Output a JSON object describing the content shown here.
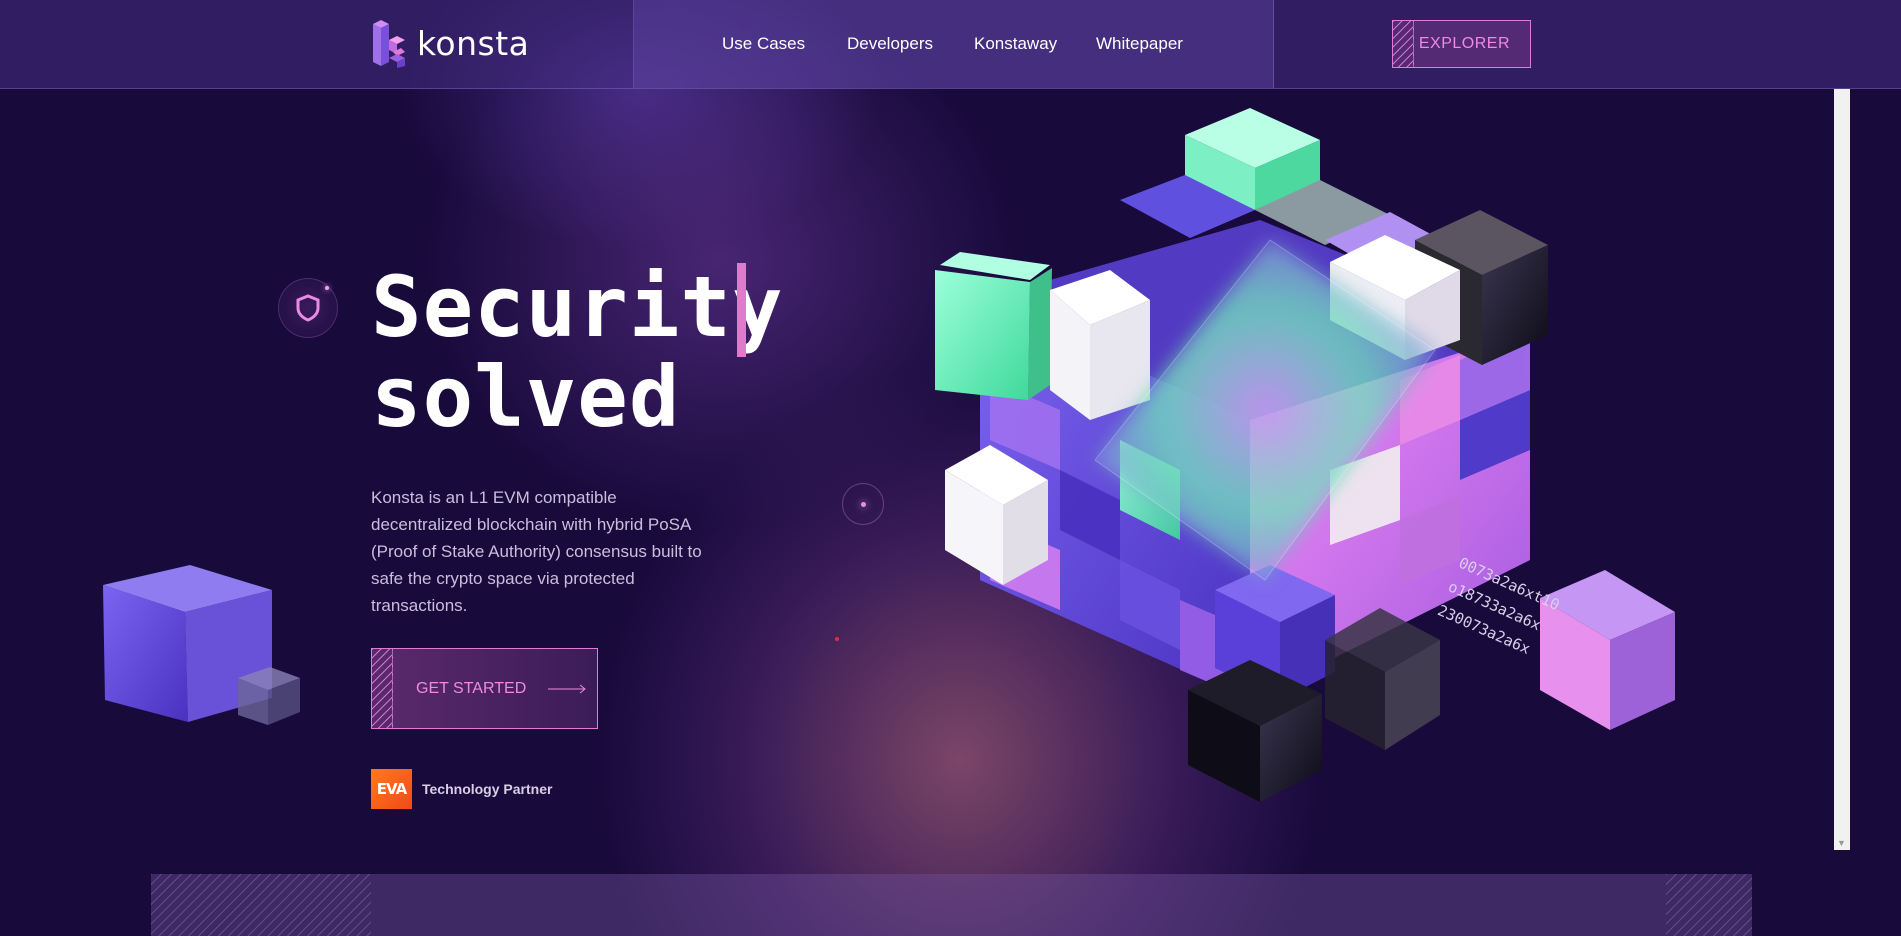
{
  "header": {
    "logo_text": "konsta",
    "nav": [
      "Use Cases",
      "Developers",
      "Konstaway",
      "Whitepaper"
    ],
    "explorer_label": "EXPLORER"
  },
  "hero": {
    "title_line1": "Security",
    "title_line2": "solved",
    "description": "Konsta is an L1 EVM compatible decentralized blockchain with hybrid PoSA (Proof of Stake Authority) consensus built to safe the crypto space via protected transactions.",
    "cta_label": "GET STARTED",
    "partner_logo_text": "EVA",
    "partner_label": "Technology Partner",
    "hash_lines": [
      "0073a2a6xt10",
      "o18733a2a6x",
      "230073a2a6x"
    ]
  },
  "icons": {
    "logo": "konsta-logo-icon",
    "badge": "shield-icon",
    "cta_arrow": "arrow-right-icon"
  },
  "colors": {
    "background": "#190a3c",
    "accent_pink": "#f08ae3",
    "mint": "#5ff0b8",
    "violet": "#6a4fe0"
  }
}
